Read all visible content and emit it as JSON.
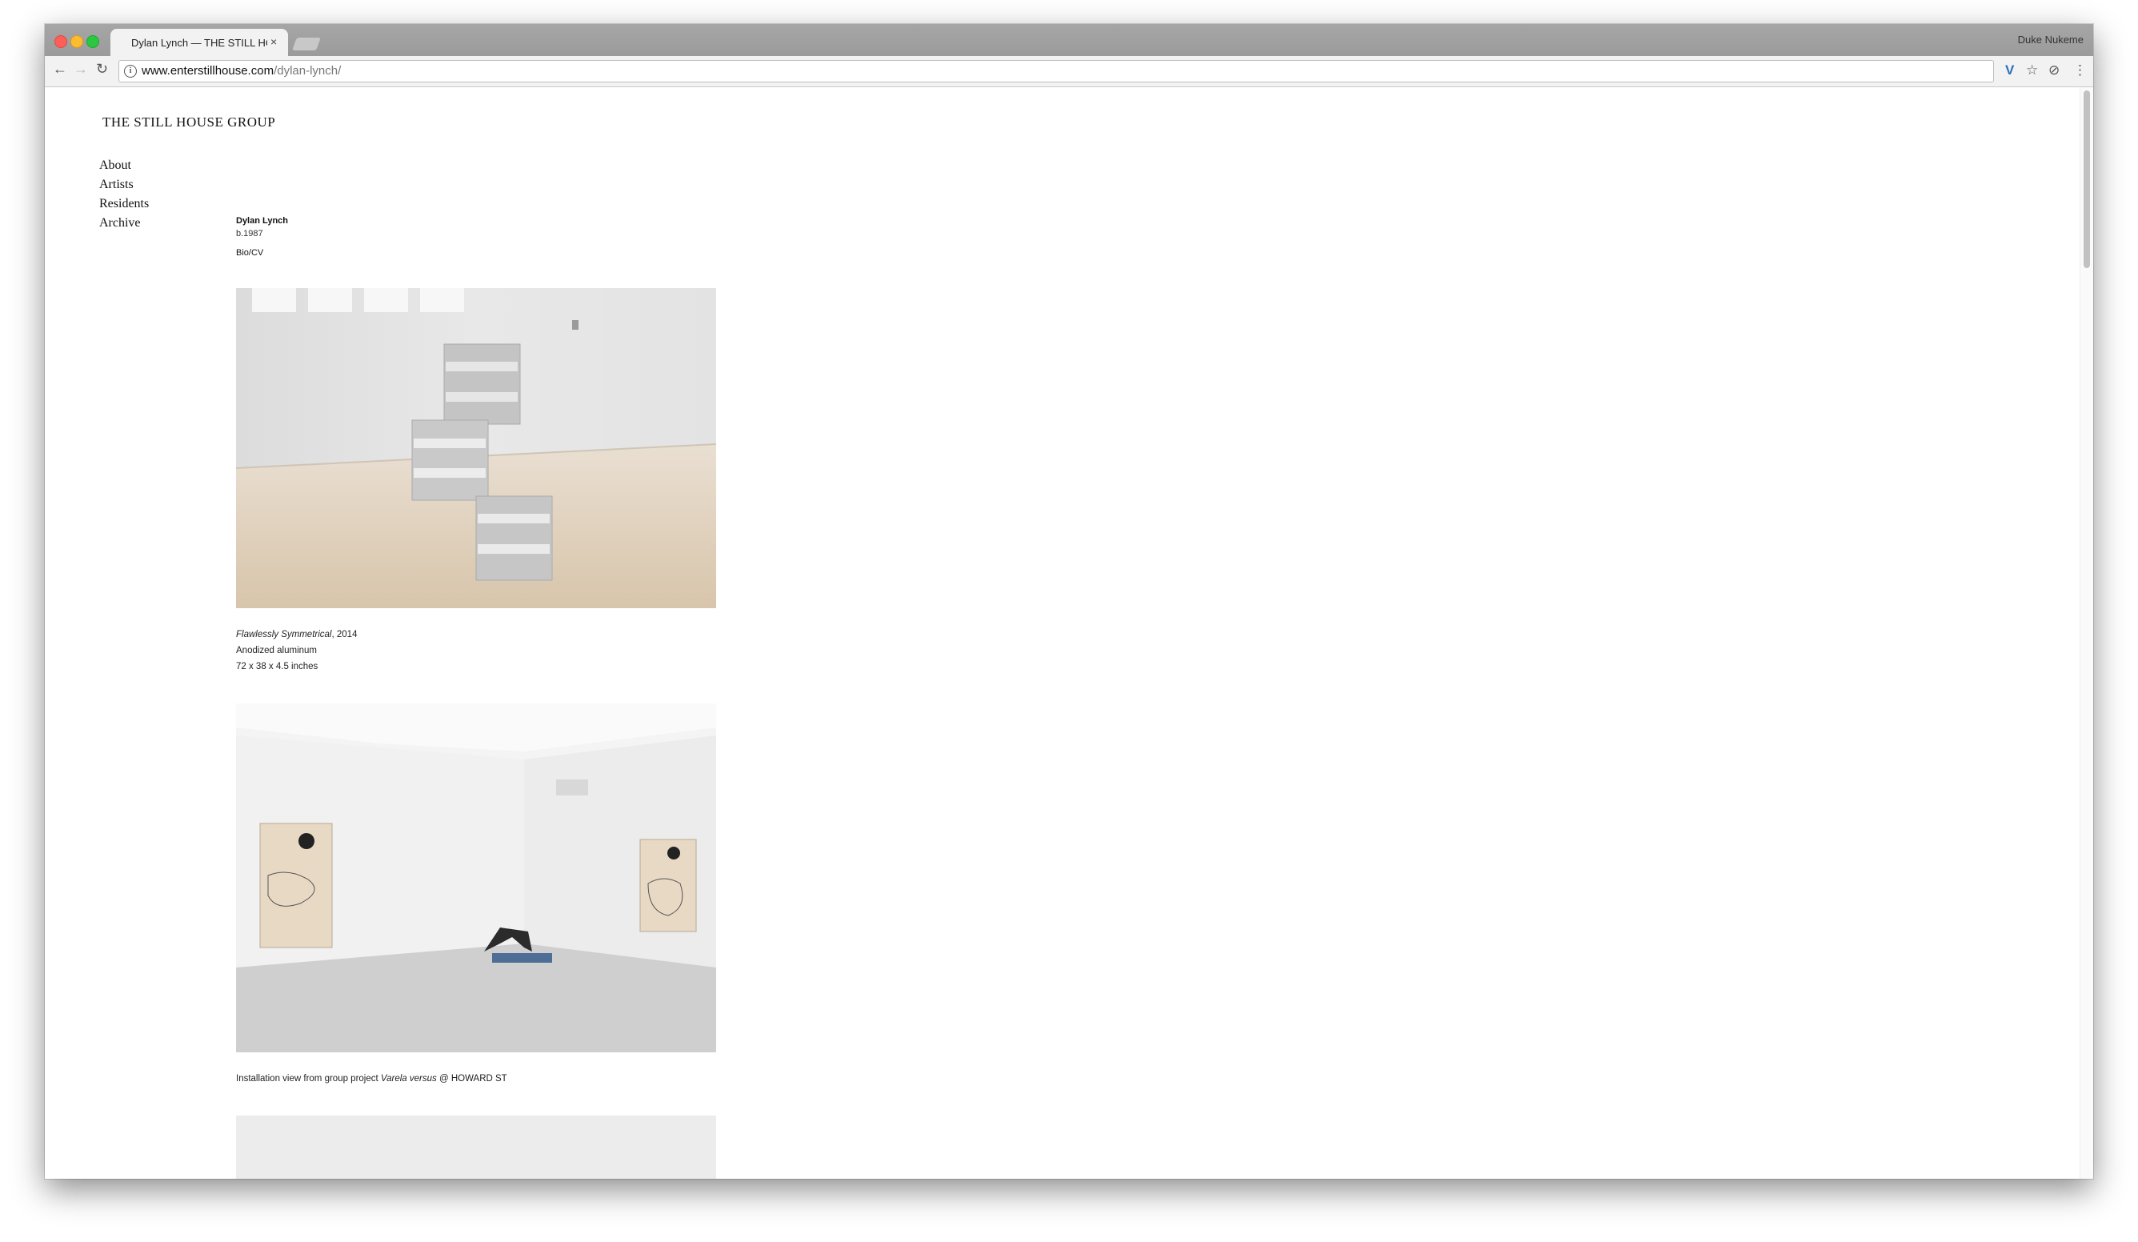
{
  "browser": {
    "tab_title": "Dylan Lynch — THE STILL HOUSE GROUP",
    "tab_close": "×",
    "profile_name": "Duke Nukeme",
    "url_host": "www.enterstillhouse.com",
    "url_path": "/dylan-lynch/",
    "icons": {
      "back": "←",
      "forward": "→",
      "reload": "↻",
      "info": "i",
      "extension": "V",
      "star": "☆",
      "sync": "⊘",
      "menu": "⋮"
    }
  },
  "site": {
    "title": "THE STILL HOUSE GROUP",
    "nav": [
      "About",
      "Artists",
      "Residents",
      "Archive"
    ]
  },
  "artist": {
    "name": "Dylan Lynch",
    "born": "b.1987",
    "bio_link": "Bio/CV"
  },
  "works": [
    {
      "title": "Flawlessly Symmetrical",
      "year": ", 2014",
      "material": "Anodized aluminum",
      "dimensions": "72 x 38 x 4.5 inches"
    },
    {
      "caption_before": "Installation view from group project ",
      "caption_em": "Varela versus",
      "caption_after": " @ HOWARD ST"
    }
  ]
}
